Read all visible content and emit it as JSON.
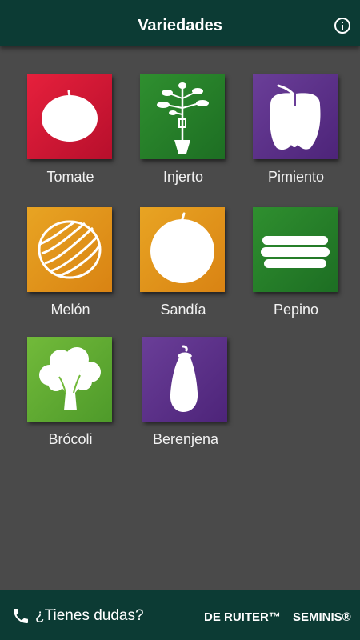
{
  "header": {
    "title": "Variedades",
    "info_icon": "info-circle-icon"
  },
  "varieties": [
    {
      "label": "Tomate",
      "icon": "tomato-icon",
      "color": "#e6203c"
    },
    {
      "label": "Injerto",
      "icon": "grafted-plant-icon",
      "color": "#2f8f2f"
    },
    {
      "label": "Pimiento",
      "icon": "pepper-icon",
      "color": "#6a3e98"
    },
    {
      "label": "Melón",
      "icon": "melon-icon",
      "color": "#e8a423"
    },
    {
      "label": "Sandía",
      "icon": "watermelon-icon",
      "color": "#e8a423"
    },
    {
      "label": "Pepino",
      "icon": "cucumber-icon",
      "color": "#2f8f2f"
    },
    {
      "label": "Brócoli",
      "icon": "broccoli-icon",
      "color": "#72ba3a"
    },
    {
      "label": "Berenjena",
      "icon": "eggplant-icon",
      "color": "#6a3e98"
    }
  ],
  "footer": {
    "help_label": "¿Tienes dudas?",
    "help_icon": "phone-icon",
    "brand_1": "DE RUITER™",
    "brand_2": "SEMINIS®"
  },
  "colors": {
    "header_bg": "#0c3b34",
    "main_bg": "#4a4a4a"
  }
}
